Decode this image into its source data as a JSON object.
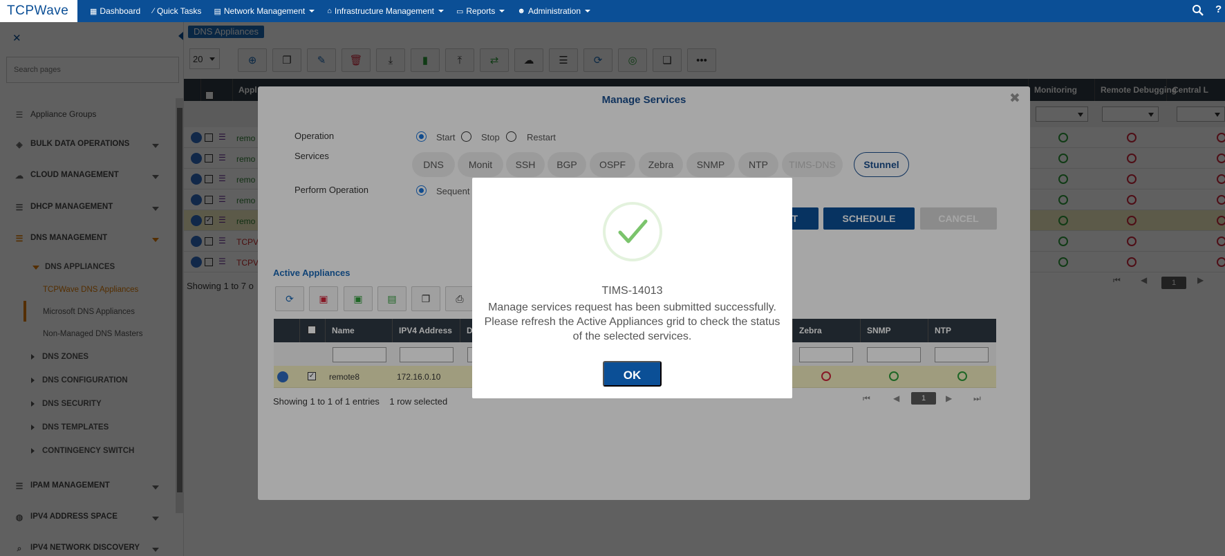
{
  "topbar": {
    "logo": "TCPWave",
    "nav": [
      {
        "label": "Dashboard",
        "icon": "dashboard-icon"
      },
      {
        "label": "Quick Tasks",
        "icon": "wand-icon"
      },
      {
        "label": "Network Management",
        "icon": "network-icon"
      },
      {
        "label": "Infrastructure Management",
        "icon": "building-icon"
      },
      {
        "label": "Reports",
        "icon": "book-icon"
      },
      {
        "label": "Administration",
        "icon": "users-icon"
      }
    ]
  },
  "sidebar": {
    "search_placeholder": "Search pages",
    "items": [
      {
        "label": "Appliance Groups",
        "icon": "server-icon"
      },
      {
        "label": "BULK DATA OPERATIONS",
        "icon": "cubes-icon"
      },
      {
        "label": "CLOUD MANAGEMENT",
        "icon": "cloud-icon"
      },
      {
        "label": "DHCP MANAGEMENT",
        "icon": "server-icon"
      },
      {
        "label": "DNS MANAGEMENT",
        "icon": "server-icon"
      }
    ],
    "dns_sub": {
      "appliances": "DNS APPLIANCES",
      "tcpwave": "TCPWave DNS Appliances",
      "microsoft": "Microsoft DNS Appliances",
      "nonmanaged": "Non-Managed DNS Masters",
      "zones": "DNS ZONES",
      "config": "DNS CONFIGURATION",
      "security": "DNS SECURITY",
      "templates": "DNS TEMPLATES",
      "contingency": "CONTINGENCY SWITCH"
    },
    "bottom_items": [
      {
        "label": "IPAM MANAGEMENT",
        "icon": "server-icon"
      },
      {
        "label": "IPV4 ADDRESS SPACE",
        "icon": "globe-icon"
      },
      {
        "label": "IPV4 NETWORK DISCOVERY",
        "icon": "search-icon"
      }
    ]
  },
  "main": {
    "breadcrumb": "DNS Appliances",
    "page_size": "20",
    "columns": [
      "Appl",
      "Monitoring",
      "Remote Debugging",
      "Central L"
    ],
    "rows": [
      {
        "name": "remo",
        "color": "green"
      },
      {
        "name": "remo",
        "color": "green"
      },
      {
        "name": "remo",
        "color": "green"
      },
      {
        "name": "remo",
        "color": "green"
      },
      {
        "name": "remo",
        "color": "green"
      },
      {
        "name": "TCPV",
        "color": "red"
      },
      {
        "name": "TCPV",
        "color": "red"
      }
    ],
    "showing": "Showing 1 to 7 o",
    "page": "1"
  },
  "manage_services": {
    "title": "Manage Services",
    "operation_label": "Operation",
    "operations": [
      "Start",
      "Stop",
      "Restart"
    ],
    "services_label": "Services",
    "services": [
      "DNS",
      "Monit",
      "SSH",
      "BGP",
      "OSPF",
      "Zebra",
      "SNMP",
      "NTP",
      "TIMS-DNS",
      "Stunnel"
    ],
    "perform_label": "Perform Operation",
    "perform_option": "Sequent",
    "submit_label": "T",
    "schedule_label": "SCHEDULE",
    "cancel_label": "CANCEL",
    "active_title": "Active Appliances",
    "active_columns": [
      "Name",
      "IPV4 Address",
      "D",
      "Zebra",
      "SNMP",
      "NTP"
    ],
    "active_row": {
      "name": "remote8",
      "ip": "172.16.0.10"
    },
    "showing": "Showing 1 to 1 of 1 entries",
    "selected": "1 row selected",
    "page": "1"
  },
  "dialog": {
    "code": "TIMS-14013",
    "message": "Manage services request has been submitted successfully. Please refresh the Active Appliances grid to check the status of the selected services.",
    "ok_label": "OK"
  },
  "colors": {
    "brand": "#0b4f96",
    "accent": "#e07b00",
    "success": "#2e9d3a",
    "error": "#d0263b"
  }
}
